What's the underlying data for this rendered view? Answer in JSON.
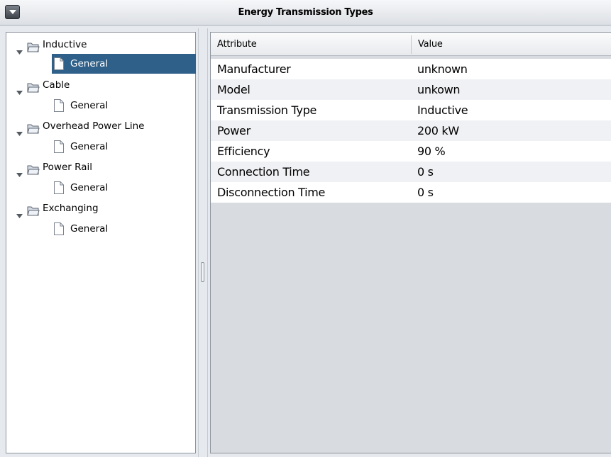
{
  "window": {
    "title": "Energy Transmission Types",
    "menu_icon": "chevron-down-icon"
  },
  "tree": {
    "nodes": [
      {
        "label": "Inductive",
        "icon": "open-folder-icon",
        "expanded": true,
        "children": [
          {
            "label": "General",
            "icon": "document-icon",
            "selected": true
          }
        ]
      },
      {
        "label": "Cable",
        "icon": "open-folder-icon",
        "expanded": true,
        "children": [
          {
            "label": "General",
            "icon": "document-icon"
          }
        ]
      },
      {
        "label": "Overhead Power Line",
        "icon": "open-folder-icon",
        "expanded": true,
        "children": [
          {
            "label": "General",
            "icon": "document-icon"
          }
        ]
      },
      {
        "label": "Power Rail",
        "icon": "open-folder-icon",
        "expanded": true,
        "children": [
          {
            "label": "General",
            "icon": "document-icon"
          }
        ]
      },
      {
        "label": "Exchanging",
        "icon": "open-folder-icon",
        "expanded": true,
        "children": [
          {
            "label": "General",
            "icon": "document-icon"
          }
        ]
      }
    ],
    "selection_color": "#2e6089"
  },
  "table": {
    "columns": [
      "Attribute",
      "Value"
    ],
    "rows": [
      [
        "Manufacturer",
        "unknown"
      ],
      [
        "Model",
        "unkown"
      ],
      [
        "Transmission Type",
        "Inductive"
      ],
      [
        "Power",
        "200 kW"
      ],
      [
        "Efficiency",
        "90 %"
      ],
      [
        "Connection Time",
        "0 s"
      ],
      [
        "Disconnection Time",
        "0 s"
      ]
    ]
  }
}
